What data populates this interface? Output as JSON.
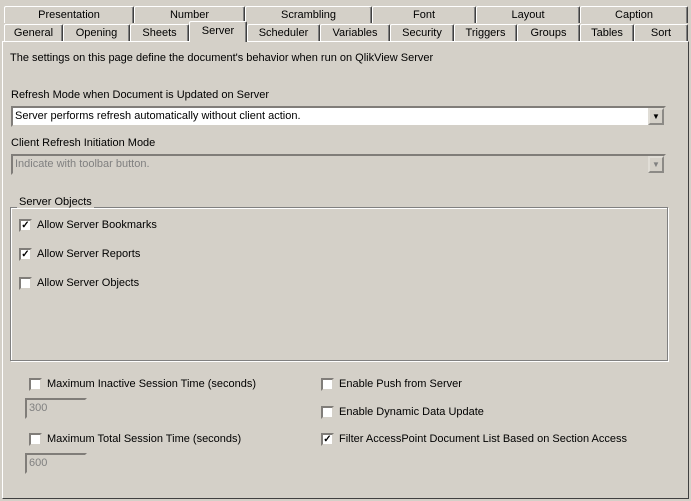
{
  "tabs_top": [
    "Presentation",
    "Number",
    "Scrambling",
    "Font",
    "Layout",
    "Caption"
  ],
  "tabs_bottom": [
    "General",
    "Opening",
    "Sheets",
    "Server",
    "Scheduler",
    "Variables",
    "Security",
    "Triggers",
    "Groups",
    "Tables",
    "Sort"
  ],
  "selected_tab": "Server",
  "description": "The settings on this page define the document's behavior when run on QlikView Server",
  "refresh_mode": {
    "label": "Refresh Mode when Document is Updated on Server",
    "value": "Server performs refresh automatically without client action."
  },
  "client_refresh": {
    "label": "Client Refresh Initiation Mode",
    "value": "Indicate with toolbar button.",
    "disabled": true
  },
  "server_objects": {
    "title": "Server Objects",
    "items": [
      {
        "label": "Allow Server Bookmarks",
        "checked": true
      },
      {
        "label": "Allow Server Reports",
        "checked": true
      },
      {
        "label": "Allow Server Objects",
        "checked": false
      }
    ]
  },
  "session": {
    "max_inactive": {
      "label": "Maximum Inactive Session Time (seconds)",
      "checked": false,
      "value": "300"
    },
    "max_total": {
      "label": "Maximum Total Session Time (seconds)",
      "checked": false,
      "value": "600"
    }
  },
  "options": [
    {
      "label": "Enable Push from Server",
      "checked": false
    },
    {
      "label": "Enable Dynamic Data Update",
      "checked": false
    },
    {
      "label": "Filter AccessPoint Document List Based on Section Access",
      "checked": true
    }
  ]
}
